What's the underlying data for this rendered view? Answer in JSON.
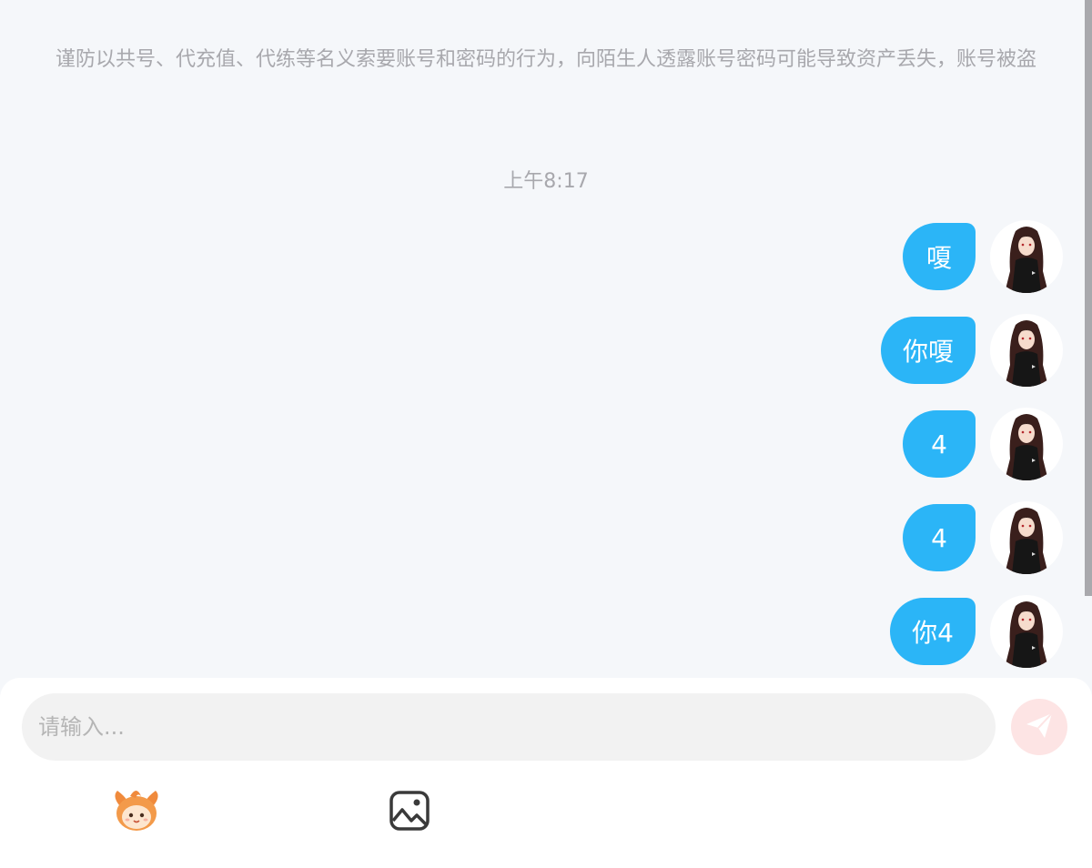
{
  "notice": "谨防以共号、代充值、代练等名义索要账号和密码的行为，向陌生人透露账号密码可能导致资产丢失，账号被盗",
  "timestamp": "上午8:17",
  "messages": [
    {
      "text": "嗄"
    },
    {
      "text": "你嗄"
    },
    {
      "text": "4"
    },
    {
      "text": "4"
    },
    {
      "text": "你4"
    }
  ],
  "composer": {
    "placeholder": "请输入..."
  },
  "icons": {
    "send": "paper-plane-icon",
    "sticker": "mascot-sticker-icon",
    "image": "image-icon",
    "avatar": "user-avatar"
  },
  "colors": {
    "bubble": "#2bb5f7",
    "background": "#f5f7fa",
    "send_button": "#fde4e4"
  }
}
